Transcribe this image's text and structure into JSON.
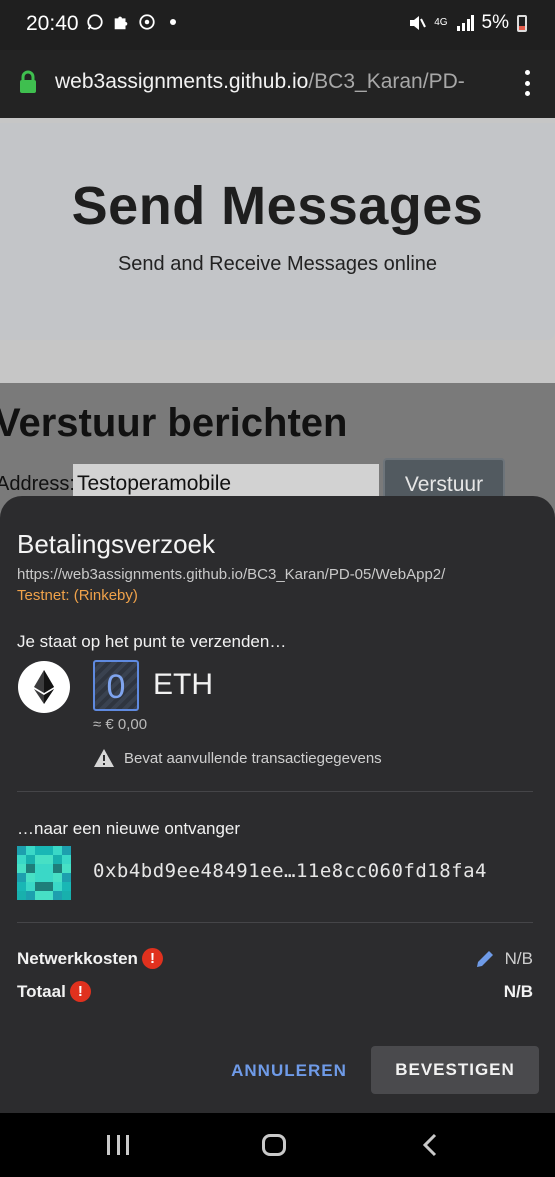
{
  "status_bar": {
    "time": "20:40",
    "network": "4G",
    "battery": "5%"
  },
  "browser": {
    "url_domain": "web3assignments.github.io",
    "url_path": "/BC3_Karan/PD-"
  },
  "page": {
    "title": "Send Messages",
    "subtitle": "Send and Receive Messages online",
    "section_title": "Verstuur berichten",
    "address_label": "Address:",
    "address_value": "Testoperamobile",
    "send_button": "Verstuur"
  },
  "payment_sheet": {
    "title": "Betalingsverzoek",
    "origin_url": "https://web3assignments.github.io/BC3_Karan/PD-05/WebApp2/",
    "network": "Testnet: (Rinkeby)",
    "send_heading": "Je staat op het punt te verzenden…",
    "amount": "0",
    "unit": "ETH",
    "fiat_value": "≈ € 0,00",
    "data_warning": "Bevat aanvullende transactiegegevens",
    "recipient_heading": "…naar een nieuwe ontvanger",
    "recipient_address": "0xb4bd9ee48491ee…11e8cc060fd18fa4",
    "fee_label": "Netwerkkosten",
    "fee_value": "N/B",
    "total_label": "Totaal",
    "total_value": "N/B",
    "cancel_label": "ANNULEREN",
    "confirm_label": "BEVESTIGEN"
  },
  "colors": {
    "accent": "#6f9be8",
    "warning": "#f0a24a",
    "error": "#e0311e",
    "sheet_bg": "#2c2c2e"
  }
}
